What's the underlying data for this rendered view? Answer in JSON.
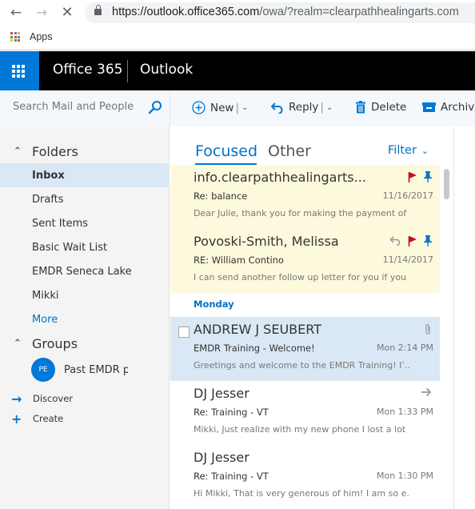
{
  "browser": {
    "url_domain": "https://outlook.office365.com",
    "url_path": "/owa/?realm=clearpathhealingarts.com",
    "bookmarks": [
      {
        "label": "Apps",
        "icon": "apps-grid-icon"
      }
    ],
    "apps_colors": [
      "#ea4335",
      "#4285f4",
      "#fbbc05",
      "#34a853",
      "#ea4335",
      "#4285f4",
      "#fbbc05",
      "#34a853",
      "#ea4335"
    ]
  },
  "suite": {
    "brand": "Office 365",
    "app": "Outlook",
    "accent": "#0078d7"
  },
  "search": {
    "placeholder": "Search Mail and People"
  },
  "toolbar": {
    "new_label": "New",
    "reply_label": "Reply",
    "delete_label": "Delete",
    "archive_label": "Archive"
  },
  "folders": {
    "header": "Folders",
    "items": [
      {
        "label": "Inbox",
        "selected": true
      },
      {
        "label": "Drafts"
      },
      {
        "label": "Sent Items"
      },
      {
        "label": "Basic Wait List"
      },
      {
        "label": "EMDR Seneca Lake"
      },
      {
        "label": "Mikki"
      }
    ],
    "more_label": "More"
  },
  "groups": {
    "header": "Groups",
    "items": [
      {
        "initials": "PE",
        "name": "Past EMDR pa"
      }
    ],
    "discover_label": "Discover",
    "create_label": "Create"
  },
  "list": {
    "tabs": [
      {
        "label": "Focused",
        "active": true
      },
      {
        "label": "Other"
      }
    ],
    "filter_label": "Filter",
    "day_header": "Monday",
    "messages": [
      {
        "sender": "info.clearpathhealingarts...",
        "subject": "Re: balance",
        "date": "11/16/2017",
        "preview": "Dear Julie,  thank you for making the payment of ...",
        "flagged": true,
        "pinned": true
      },
      {
        "sender": "Povoski-Smith, Melissa",
        "subject": "RE: William Contino",
        "date": "11/14/2017",
        "preview": "I can send another follow up letter for you if you ...",
        "replied": true,
        "flagged": true,
        "pinned": true
      },
      {
        "sender": "ANDREW J SEUBERT",
        "subject": "EMDR Training - Welcome!",
        "date": "Mon 2:14 PM",
        "preview": "Greetings and welcome to the EMDR Training!  I’...",
        "attachment": true,
        "selected": true
      },
      {
        "sender": "DJ Jesser",
        "subject": "Re: Training - VT",
        "date": "Mon 1:33 PM",
        "preview": "Mikki,  Just realize with my new phone I lost a lot ...",
        "forwarded": true
      },
      {
        "sender": "DJ Jesser",
        "subject": "Re: Training - VT",
        "date": "Mon 1:30 PM",
        "preview": "Hi Mikki,  That is very generous of him! I am so e..."
      }
    ]
  }
}
